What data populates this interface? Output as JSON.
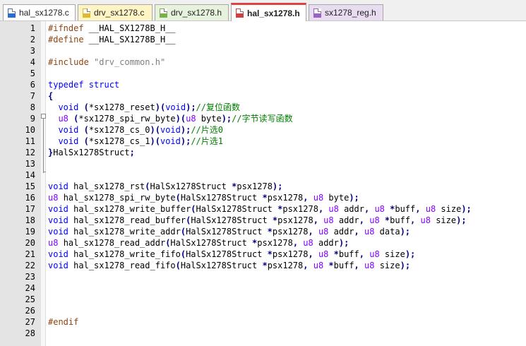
{
  "tabs": [
    {
      "label": "hal_sx1278.c",
      "icon": "c-file-icon",
      "bg": "#ffffff",
      "icon_color": "#2a6bd6"
    },
    {
      "label": "drv_sx1278.c",
      "icon": "c-file-icon",
      "bg": "#fff4c4",
      "icon_color": "#e0b830"
    },
    {
      "label": "drv_sx1278.h",
      "icon": "h-file-icon",
      "bg": "#e6f2dc",
      "icon_color": "#7ab04a"
    },
    {
      "label": "hal_sx1278.h",
      "icon": "h-file-icon",
      "bg": "#ffffff",
      "icon_color": "#d04040",
      "active": true
    },
    {
      "label": "sx1278_reg.h",
      "icon": "h-file-icon",
      "bg": "#e8dcf0",
      "icon_color": "#9a62c4"
    }
  ],
  "lines": [
    {
      "n": "1",
      "t": [
        [
          "pp",
          "#ifndef "
        ],
        [
          "tx",
          "__HAL_SX1278B_H__"
        ]
      ]
    },
    {
      "n": "2",
      "t": [
        [
          "pp",
          "#define "
        ],
        [
          "tx",
          "__HAL_SX1278B_H__"
        ]
      ]
    },
    {
      "n": "3",
      "t": []
    },
    {
      "n": "4",
      "t": [
        [
          "pp",
          "#include "
        ],
        [
          "st",
          "\"drv_common.h\""
        ]
      ]
    },
    {
      "n": "5",
      "t": []
    },
    {
      "n": "6",
      "t": [
        [
          "kw",
          "typedef "
        ],
        [
          "kw",
          "struct"
        ]
      ]
    },
    {
      "n": "7",
      "t": [
        [
          "op",
          "{"
        ]
      ]
    },
    {
      "n": "8",
      "t": [
        [
          "tx",
          "  "
        ],
        [
          "kw",
          "void "
        ],
        [
          "op",
          "("
        ],
        [
          "tx",
          "*sx1278_reset"
        ],
        [
          "op",
          ")("
        ],
        [
          "kw",
          "void"
        ],
        [
          "op",
          ");"
        ],
        [
          "cm",
          "//复位函数"
        ]
      ]
    },
    {
      "n": "9",
      "t": [
        [
          "tx",
          "  "
        ],
        [
          "ty",
          "u8 "
        ],
        [
          "op",
          "("
        ],
        [
          "tx",
          "*sx1278_spi_rw_byte"
        ],
        [
          "op",
          ")("
        ],
        [
          "ty",
          "u8 "
        ],
        [
          "tx",
          "byte"
        ],
        [
          "op",
          ");"
        ],
        [
          "cm",
          "//字节读写函数"
        ]
      ]
    },
    {
      "n": "10",
      "t": [
        [
          "tx",
          "  "
        ],
        [
          "kw",
          "void "
        ],
        [
          "op",
          "("
        ],
        [
          "tx",
          "*sx1278_cs_0"
        ],
        [
          "op",
          ")("
        ],
        [
          "kw",
          "void"
        ],
        [
          "op",
          ");"
        ],
        [
          "cm",
          "//片选0"
        ]
      ]
    },
    {
      "n": "11",
      "t": [
        [
          "tx",
          "  "
        ],
        [
          "kw",
          "void "
        ],
        [
          "op",
          "("
        ],
        [
          "tx",
          "*sx1278_cs_1"
        ],
        [
          "op",
          ")("
        ],
        [
          "kw",
          "void"
        ],
        [
          "op",
          ");"
        ],
        [
          "cm",
          "//片选1"
        ]
      ]
    },
    {
      "n": "12",
      "t": [
        [
          "op",
          "}"
        ],
        [
          "tx",
          "HalSx1278Struct"
        ],
        [
          "op",
          ";"
        ]
      ]
    },
    {
      "n": "13",
      "t": []
    },
    {
      "n": "14",
      "t": []
    },
    {
      "n": "15",
      "t": [
        [
          "kw",
          "void "
        ],
        [
          "tx",
          "hal_sx1278_rst"
        ],
        [
          "op",
          "("
        ],
        [
          "tx",
          "HalSx1278Struct "
        ],
        [
          "op",
          "*"
        ],
        [
          "tx",
          "psx1278"
        ],
        [
          "op",
          ");"
        ]
      ]
    },
    {
      "n": "16",
      "t": [
        [
          "ty",
          "u8 "
        ],
        [
          "tx",
          "hal_sx1278_spi_rw_byte"
        ],
        [
          "op",
          "("
        ],
        [
          "tx",
          "HalSx1278Struct "
        ],
        [
          "op",
          "*"
        ],
        [
          "tx",
          "psx1278"
        ],
        [
          "op",
          ", "
        ],
        [
          "ty",
          "u8 "
        ],
        [
          "tx",
          "byte"
        ],
        [
          "op",
          ");"
        ]
      ]
    },
    {
      "n": "17",
      "t": [
        [
          "kw",
          "void "
        ],
        [
          "tx",
          "hal_sx1278_write_buffer"
        ],
        [
          "op",
          "("
        ],
        [
          "tx",
          "HalSx1278Struct "
        ],
        [
          "op",
          "*"
        ],
        [
          "tx",
          "psx1278"
        ],
        [
          "op",
          ", "
        ],
        [
          "ty",
          "u8 "
        ],
        [
          "tx",
          "addr"
        ],
        [
          "op",
          ", "
        ],
        [
          "ty",
          "u8 "
        ],
        [
          "op",
          "*"
        ],
        [
          "tx",
          "buff"
        ],
        [
          "op",
          ", "
        ],
        [
          "ty",
          "u8 "
        ],
        [
          "tx",
          "size"
        ],
        [
          "op",
          ");"
        ]
      ]
    },
    {
      "n": "18",
      "t": [
        [
          "kw",
          "void "
        ],
        [
          "tx",
          "hal_sx1278_read_buffer"
        ],
        [
          "op",
          "("
        ],
        [
          "tx",
          "HalSx1278Struct "
        ],
        [
          "op",
          "*"
        ],
        [
          "tx",
          "psx1278"
        ],
        [
          "op",
          ", "
        ],
        [
          "ty",
          "u8 "
        ],
        [
          "tx",
          "addr"
        ],
        [
          "op",
          ", "
        ],
        [
          "ty",
          "u8 "
        ],
        [
          "op",
          "*"
        ],
        [
          "tx",
          "buff"
        ],
        [
          "op",
          ", "
        ],
        [
          "ty",
          "u8 "
        ],
        [
          "tx",
          "size"
        ],
        [
          "op",
          ");"
        ]
      ]
    },
    {
      "n": "19",
      "t": [
        [
          "kw",
          "void "
        ],
        [
          "tx",
          "hal_sx1278_write_addr"
        ],
        [
          "op",
          "("
        ],
        [
          "tx",
          "HalSx1278Struct "
        ],
        [
          "op",
          "*"
        ],
        [
          "tx",
          "psx1278"
        ],
        [
          "op",
          ", "
        ],
        [
          "ty",
          "u8 "
        ],
        [
          "tx",
          "addr"
        ],
        [
          "op",
          ", "
        ],
        [
          "ty",
          "u8 "
        ],
        [
          "tx",
          "data"
        ],
        [
          "op",
          ");"
        ]
      ]
    },
    {
      "n": "20",
      "t": [
        [
          "ty",
          "u8 "
        ],
        [
          "tx",
          "hal_sx1278_read_addr"
        ],
        [
          "op",
          "("
        ],
        [
          "tx",
          "HalSx1278Struct "
        ],
        [
          "op",
          "*"
        ],
        [
          "tx",
          "psx1278"
        ],
        [
          "op",
          ", "
        ],
        [
          "ty",
          "u8 "
        ],
        [
          "tx",
          "addr"
        ],
        [
          "op",
          ");"
        ]
      ]
    },
    {
      "n": "21",
      "t": [
        [
          "kw",
          "void "
        ],
        [
          "tx",
          "hal_sx1278_write_fifo"
        ],
        [
          "op",
          "("
        ],
        [
          "tx",
          "HalSx1278Struct "
        ],
        [
          "op",
          "*"
        ],
        [
          "tx",
          "psx1278"
        ],
        [
          "op",
          ", "
        ],
        [
          "ty",
          "u8 "
        ],
        [
          "op",
          "*"
        ],
        [
          "tx",
          "buff"
        ],
        [
          "op",
          ", "
        ],
        [
          "ty",
          "u8 "
        ],
        [
          "tx",
          "size"
        ],
        [
          "op",
          ");"
        ]
      ]
    },
    {
      "n": "22",
      "t": [
        [
          "kw",
          "void "
        ],
        [
          "tx",
          "hal_sx1278_read_fifo"
        ],
        [
          "op",
          "("
        ],
        [
          "tx",
          "HalSx1278Struct "
        ],
        [
          "op",
          "*"
        ],
        [
          "tx",
          "psx1278"
        ],
        [
          "op",
          ", "
        ],
        [
          "ty",
          "u8 "
        ],
        [
          "op",
          "*"
        ],
        [
          "tx",
          "buff"
        ],
        [
          "op",
          ", "
        ],
        [
          "ty",
          "u8 "
        ],
        [
          "tx",
          "size"
        ],
        [
          "op",
          ");"
        ]
      ]
    },
    {
      "n": "23",
      "t": []
    },
    {
      "n": "24",
      "t": []
    },
    {
      "n": "25",
      "t": []
    },
    {
      "n": "26",
      "t": []
    },
    {
      "n": "27",
      "t": [
        [
          "pp",
          "#endif"
        ]
      ]
    },
    {
      "n": "28",
      "t": []
    }
  ]
}
